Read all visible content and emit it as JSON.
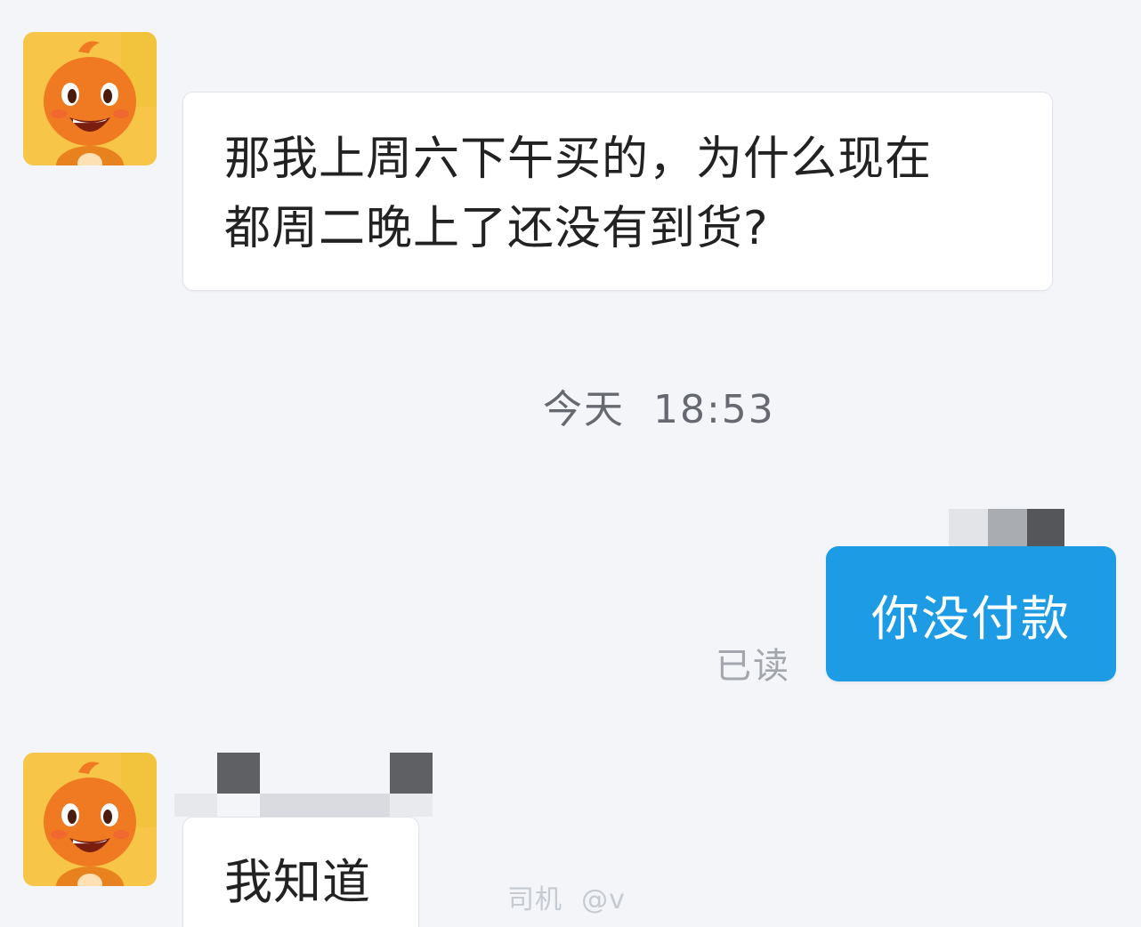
{
  "chat": {
    "messages": [
      {
        "direction": "incoming",
        "lines": [
          "那我上周六下午买的，为什么现在",
          "都周二晚上了还没有到货?"
        ]
      },
      {
        "direction": "outgoing",
        "text": "你没付款",
        "status": "已读"
      },
      {
        "direction": "incoming",
        "text": "我知道"
      }
    ],
    "timestamp": "今天  18:53"
  },
  "watermark": {
    "text": "司机  @v"
  },
  "colors": {
    "background": "#f3f5f9",
    "outgoing_bubble": "#1d9be4",
    "incoming_bubble": "#ffffff",
    "avatar_bg": "#f7c548",
    "mascot": "#f07a21"
  },
  "icons": {
    "avatar": "orange-mascot-avatar-icon"
  }
}
